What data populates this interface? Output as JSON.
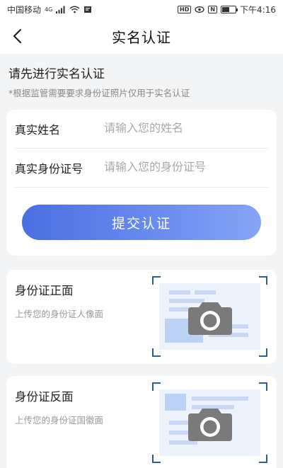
{
  "status_bar": {
    "carrier": "中国移动",
    "network": "4G",
    "time": "下午4:16",
    "hd_badge": "HD",
    "nfc_badge": "N",
    "battery_level": 0.55,
    "icons": [
      "signal-icon",
      "wifi-icon",
      "notification-icon",
      "hd-icon",
      "eye-icon",
      "nfc-icon",
      "battery-icon"
    ]
  },
  "navbar": {
    "title": "实名认证",
    "back_icon": "chevron-left-icon"
  },
  "intro": {
    "title": "请先进行实名认证",
    "note": "*根据监管需要要求身份证照片仅用于实名认证"
  },
  "form": {
    "name_label": "真实姓名",
    "name_placeholder": "请输入您的姓名",
    "name_value": "",
    "id_label": "真实身份证号",
    "id_placeholder": "请输入您的身份证号",
    "id_value": "",
    "submit_label": "提交认证"
  },
  "id_front": {
    "title": "身份证正面",
    "subtitle": "上传您的身份证人像面",
    "icon": "camera-icon"
  },
  "id_back": {
    "title": "身份证反面",
    "subtitle": "上传您的身份证国徽面",
    "icon": "camera-icon"
  },
  "colors": {
    "accent_start": "#4a6fe0",
    "accent_end": "#86a5f6",
    "frame_corner": "#2f5d9a",
    "card_illustration": "#edf3fc",
    "camera": "#7a7a7a"
  }
}
